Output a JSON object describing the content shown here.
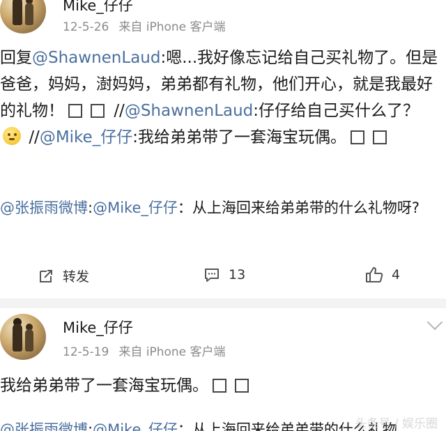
{
  "post1": {
    "username": "Mike_仔仔",
    "date": "12-5-26",
    "source": "来自 iPhone 客户端",
    "reply_prefix": "回复",
    "reply_mention": "@ShawnenLaud",
    "reply_text": ":嗯...我好像忘记给自己买礼物了。但是爸爸，妈妈，澍妈妈，弟弟都有礼物，他们开心，就是我最好的礼物！",
    "fwd1_mention": "@ShawnenLaud",
    "fwd1_text": ":仔仔给自己买什么了？",
    "fwd2_mention": "@Mike_仔仔",
    "fwd2_text": ":我给弟弟带了一套海宝玩偶。",
    "slash": "//",
    "comment_mention": "@张振雨微博",
    "comment_colon": ":",
    "comment_mention2": "@Mike_仔仔",
    "comment_text": "：从上海回来给弟弟带的什么礼物呀?",
    "actions": {
      "repost_label": "转发",
      "comment_count": "13",
      "like_count": "4"
    }
  },
  "post2": {
    "username": "Mike_仔仔",
    "date": "12-5-19",
    "source": "来自 iPhone 客户端",
    "text": "我给弟弟带了一套海宝玩偶。",
    "comment_mention": "@张振雨微博",
    "comment_colon": ":",
    "comment_mention2": "@Mike_仔仔",
    "comment_text": "：从上海回来给弟弟带的什么礼物"
  },
  "watermark": "头条号 / 娱乐圈"
}
